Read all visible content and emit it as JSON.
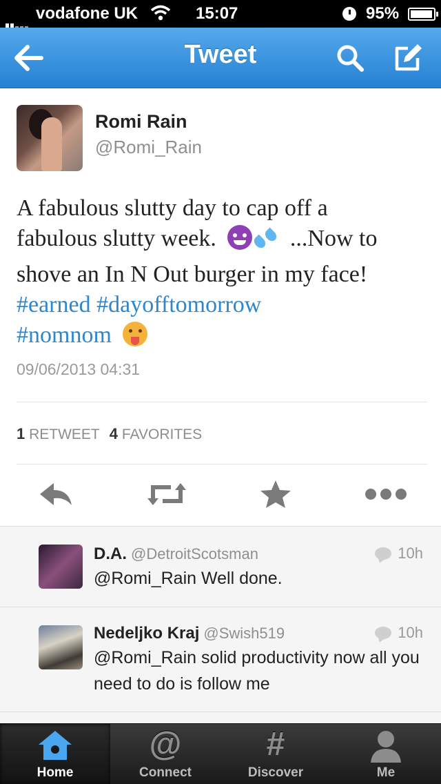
{
  "status_bar": {
    "carrier": "vodafone UK",
    "time": "15:07",
    "battery": "95%"
  },
  "nav": {
    "title": "Tweet"
  },
  "tweet": {
    "author_name": "Romi Rain",
    "author_handle": "@Romi_Rain",
    "text_line1": "A fabulous slutty day to cap off a",
    "text_line2a": "fabulous slutty week.",
    "text_line2b": "...Now to",
    "text_line3": "shove an In N Out burger in my face!",
    "hashtag1": "#earned",
    "hashtag2": "#dayofftomorrow",
    "hashtag3": "#nomnom",
    "emoji_icons": [
      "smiling-devil-icon",
      "sweat-drops-icon",
      "tongue-out-face-icon"
    ],
    "timestamp": "09/06/2013 04:31",
    "retweet_count": "1",
    "retweet_label": "RETWEET",
    "favorite_count": "4",
    "favorite_label": "FAVORITES"
  },
  "actions": [
    "reply-icon",
    "retweet-icon",
    "favorite-star-icon",
    "more-dots-icon"
  ],
  "replies": [
    {
      "name": "D.A.",
      "handle": "@DetroitScotsman",
      "time": "10h",
      "text": "@Romi_Rain Well done."
    },
    {
      "name": "Nedeljko Kraj",
      "handle": "@Swish519",
      "time": "10h",
      "text": "@Romi_Rain solid productivity now all you need to do is follow me"
    }
  ],
  "tabbar": {
    "home": "Home",
    "connect": "Connect",
    "discover": "Discover",
    "me": "Me",
    "connect_glyph": "@",
    "discover_glyph": "#"
  },
  "colors": {
    "nav_blue": "#2581d2",
    "hashtag_blue": "#2f86cc",
    "text_dark": "#222222",
    "meta_gray": "#8f8f8f"
  }
}
